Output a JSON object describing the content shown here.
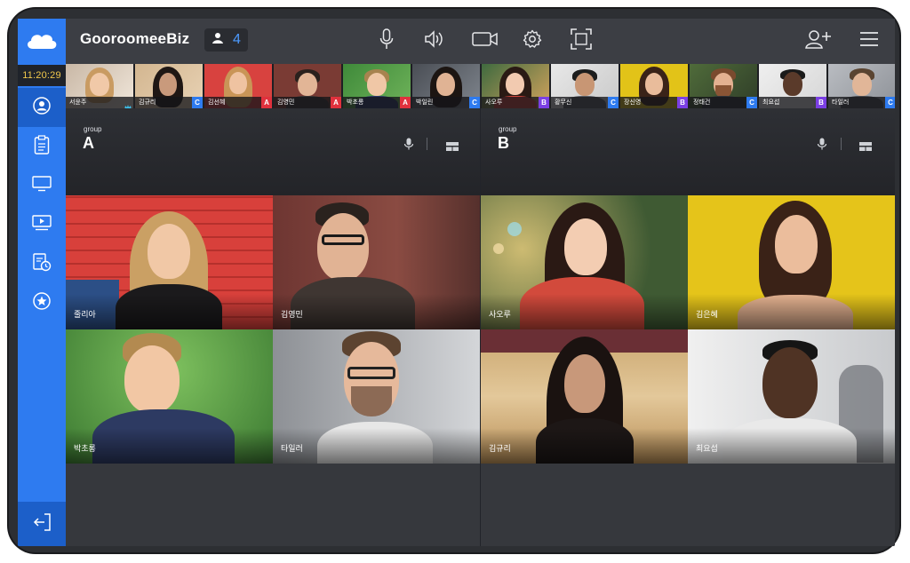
{
  "app": {
    "brand": "GooroomeeBiz",
    "participant_count": "4",
    "clock": "11:20:29"
  },
  "toolbar_icons": [
    "microphone-icon",
    "speaker-icon",
    "camera-icon",
    "settings-gear-icon",
    "fullscreen-icon"
  ],
  "right_icons": [
    "add-user-icon",
    "menu-icon"
  ],
  "sidebar": {
    "items": [
      "user-icon",
      "clipboard-icon",
      "monitor-icon",
      "screen-share-icon",
      "document-clock-icon",
      "star-icon"
    ],
    "exit": "exit-icon"
  },
  "strip": [
    {
      "name": "서윤주",
      "tag": "",
      "badge": "crown"
    },
    {
      "name": "김규리",
      "tag": "C",
      "tag_color": "#2e7bf0"
    },
    {
      "name": "김선혜",
      "tag": "A",
      "tag_color": "#e0313d"
    },
    {
      "name": "김영민",
      "tag": "A",
      "tag_color": "#e0313d"
    },
    {
      "name": "박초롱",
      "tag": "A",
      "tag_color": "#e0313d"
    },
    {
      "name": "박일린",
      "tag": "C",
      "tag_color": "#2e7bf0"
    },
    {
      "name": "사오루",
      "tag": "B",
      "tag_color": "#7b3fe4"
    },
    {
      "name": "황무신",
      "tag": "C",
      "tag_color": "#2e7bf0"
    },
    {
      "name": "장신영",
      "tag": "B",
      "tag_color": "#7b3fe4"
    },
    {
      "name": "정태건",
      "tag": "C",
      "tag_color": "#2e7bf0"
    },
    {
      "name": "최요섭",
      "tag": "B",
      "tag_color": "#7b3fe4"
    },
    {
      "name": "타일러",
      "tag": "C",
      "tag_color": "#2e7bf0"
    }
  ],
  "groups": [
    {
      "label_small": "group",
      "label": "A",
      "tiles": [
        {
          "name": "줄리아"
        },
        {
          "name": "김영민"
        },
        {
          "name": "박초롱"
        },
        {
          "name": "타일러"
        }
      ]
    },
    {
      "label_small": "group",
      "label": "B",
      "tiles": [
        {
          "name": "사오루"
        },
        {
          "name": "김은혜"
        },
        {
          "name": "김규리"
        },
        {
          "name": "최요섭"
        }
      ]
    }
  ],
  "colors": {
    "accent": "#2e7bf0",
    "tag_a": "#e0313d",
    "tag_b": "#7b3fe4",
    "tag_c": "#2e7bf0"
  }
}
